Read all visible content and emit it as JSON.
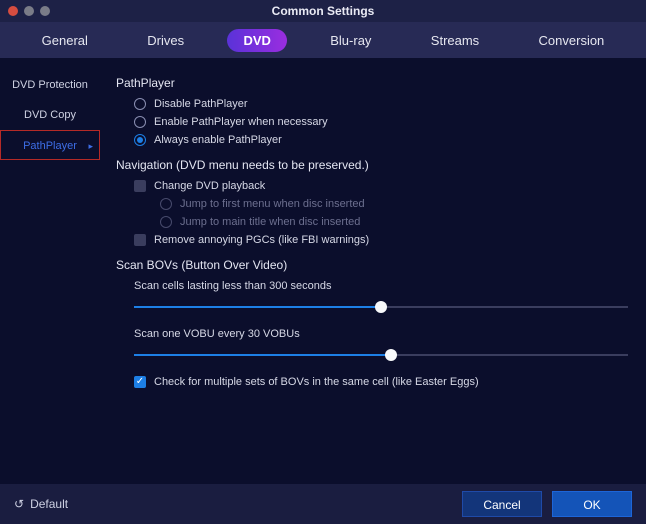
{
  "window": {
    "title": "Common Settings"
  },
  "topnav": {
    "items": [
      {
        "label": "General"
      },
      {
        "label": "Drives"
      },
      {
        "label": "DVD"
      },
      {
        "label": "Blu-ray"
      },
      {
        "label": "Streams"
      },
      {
        "label": "Conversion"
      }
    ],
    "active_index": 2
  },
  "sidebar": {
    "items": [
      {
        "label": "DVD Protection"
      },
      {
        "label": "DVD Copy"
      },
      {
        "label": "PathPlayer"
      }
    ],
    "selected_index": 2
  },
  "sections": {
    "pathplayer": {
      "title": "PathPlayer",
      "options": {
        "disable": "Disable PathPlayer",
        "enable_when_necessary": "Enable PathPlayer when necessary",
        "always_enable": "Always enable PathPlayer"
      },
      "selected": "always_enable"
    },
    "navigation": {
      "title": "Navigation (DVD menu needs to be preserved.)",
      "change_playback": {
        "label": "Change DVD playback",
        "checked": false
      },
      "jump_first_menu": {
        "label": "Jump to first menu when disc inserted"
      },
      "jump_main_title": {
        "label": "Jump to main title when disc inserted"
      },
      "remove_pgcs": {
        "label": "Remove annoying PGCs (like FBI warnings)",
        "checked": false
      }
    },
    "bovs": {
      "title": "Scan BOVs (Button Over Video)",
      "slider_cells": {
        "label": "Scan cells lasting less than 300 seconds",
        "percent": 50
      },
      "slider_vobu": {
        "label": "Scan one VOBU every 30 VOBUs",
        "percent": 52
      },
      "check_multiple": {
        "label": "Check for multiple sets of BOVs in the same cell (like Easter Eggs)",
        "checked": true
      }
    }
  },
  "footer": {
    "default": "Default",
    "cancel": "Cancel",
    "ok": "OK"
  }
}
